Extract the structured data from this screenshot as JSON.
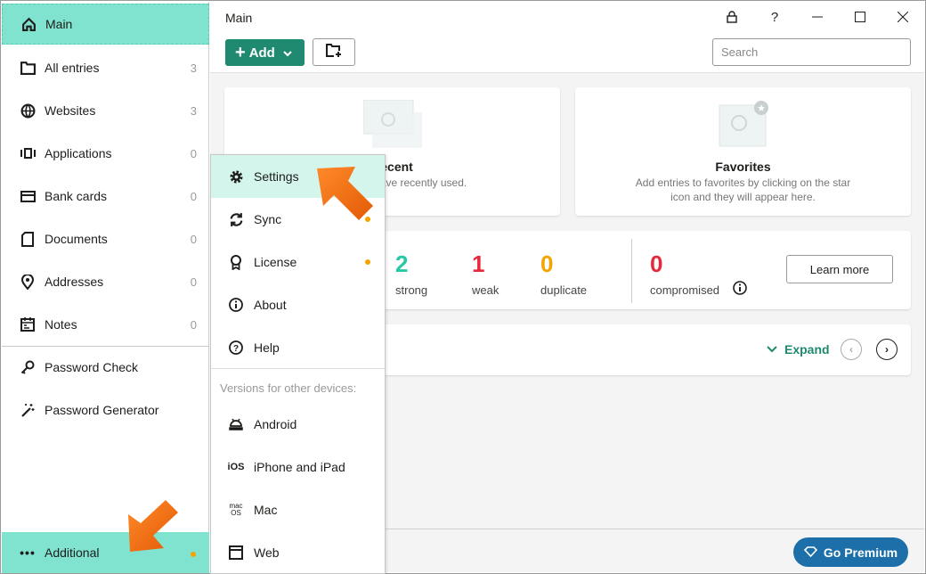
{
  "sidebar": {
    "items": [
      {
        "label": "Main",
        "icon": "home-icon"
      },
      {
        "label": "All entries",
        "count": "3",
        "icon": "folder-icon"
      },
      {
        "label": "Websites",
        "count": "3",
        "icon": "globe-icon"
      },
      {
        "label": "Applications",
        "count": "0",
        "icon": "application-icon"
      },
      {
        "label": "Bank cards",
        "count": "0",
        "icon": "card-icon"
      },
      {
        "label": "Documents",
        "count": "0",
        "icon": "document-icon"
      },
      {
        "label": "Addresses",
        "count": "0",
        "icon": "location-pin-icon"
      },
      {
        "label": "Notes",
        "count": "0",
        "icon": "notes-icon"
      },
      {
        "label": "Password Check",
        "icon": "key-icon"
      },
      {
        "label": "Password Generator",
        "icon": "magic-wand-icon"
      }
    ],
    "additional": "Additional"
  },
  "header": {
    "title": "Main",
    "add_label": "Add",
    "search_placeholder": "Search",
    "lock": "🔒",
    "help": "?"
  },
  "recent": {
    "title": "Recent",
    "desc": "Entries you have recently used."
  },
  "favorites": {
    "title": "Favorites",
    "desc": "Add entries to favorites by clicking on the star icon and they will appear here."
  },
  "stats": {
    "strong": {
      "value": "2",
      "label": "strong",
      "color": "#26c9a5"
    },
    "weak": {
      "value": "1",
      "label": "weak",
      "color": "#e8283c"
    },
    "duplicate": {
      "value": "0",
      "label": "duplicate",
      "color": "#f5a300"
    },
    "compromised": {
      "value": "0",
      "label": "compromised",
      "color": "#e8283c"
    },
    "learn_more": "Learn more"
  },
  "tips": {
    "expand": "Expand"
  },
  "premium": "Go Premium",
  "menu": {
    "items": [
      {
        "label": "Settings",
        "icon": "gear-icon"
      },
      {
        "label": "Sync",
        "icon": "sync-icon"
      },
      {
        "label": "License",
        "icon": "license-icon"
      },
      {
        "label": "About",
        "icon": "info-icon"
      },
      {
        "label": "Help",
        "icon": "help-icon"
      }
    ],
    "section_label": "Versions for other devices:",
    "devices": [
      {
        "label": "Android",
        "icon": "android-icon"
      },
      {
        "label": "iPhone and iPad",
        "icon": "ios-icon",
        "glyph": "iOS"
      },
      {
        "label": "Mac",
        "icon": "macos-icon",
        "glyph": "mac OS"
      },
      {
        "label": "Web",
        "icon": "web-window-icon"
      }
    ]
  },
  "colors": {
    "accent": "#1f8a70",
    "highlight": "#7fe3cf",
    "menu_highlight": "#d3f5ec",
    "premium": "#1c6fa8",
    "arrow": "#f07018",
    "badge_dot": "#f5a300"
  }
}
